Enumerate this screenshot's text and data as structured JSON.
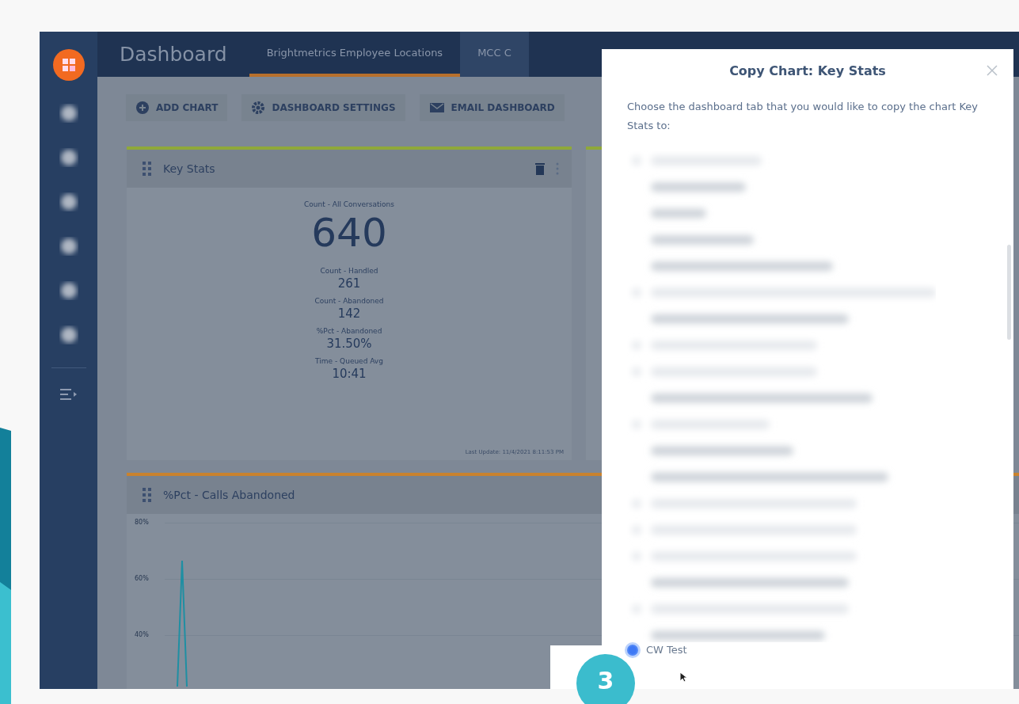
{
  "app": {
    "title": "Dashboard",
    "tabs": [
      {
        "label": "Brightmetrics Employee Locations",
        "selected": true
      },
      {
        "label": "MCC C",
        "selected": false
      }
    ]
  },
  "toolbar": {
    "buttons": [
      {
        "kind": "add",
        "label": "ADD CHART"
      },
      {
        "kind": "settings",
        "label": "DASHBOARD SETTINGS"
      },
      {
        "kind": "email",
        "label": "EMAIL DASHBOARD"
      }
    ]
  },
  "key_stats": {
    "title": "Key Stats",
    "color": "#8fa83a",
    "stats": [
      {
        "label": "Count - All Conversations",
        "value": "640",
        "kind": "main"
      },
      {
        "label": "Count - Handled",
        "value": "261",
        "kind": "sub"
      },
      {
        "label": "Count - Abandoned",
        "value": "142",
        "kind": "sub"
      },
      {
        "label": "%Pct - Abandoned",
        "value": "31.50%",
        "kind": "sub"
      },
      {
        "label": "Time - Queued Avg",
        "value": "10:41",
        "kind": "sub"
      }
    ],
    "footer": "Last Update: 11/4/2021 8:11:53 PM"
  },
  "chart_card": {
    "title": "%Pct - Calls Abandoned",
    "color": "#c9822e",
    "y_axis_labels": [
      "80%",
      "60%",
      "40%"
    ]
  },
  "dialog": {
    "title": "Copy Chart: Key Stats",
    "description": "Choose the dashboard tab that you would like to copy the chart Key Stats to:",
    "options": [
      {
        "label": "CW Test",
        "selected": true
      }
    ]
  },
  "badge": "3"
}
